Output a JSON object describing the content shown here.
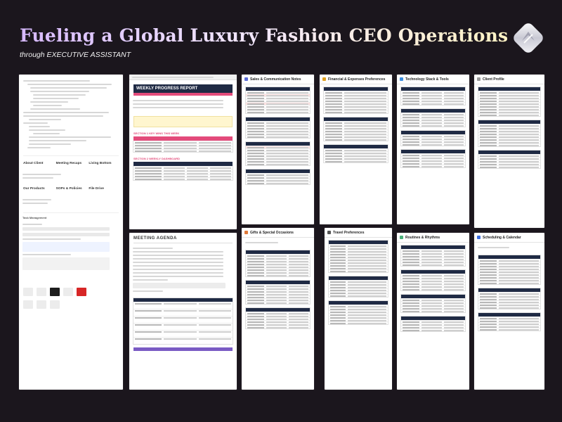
{
  "header": {
    "title": "Fueling a Global Luxury Fashion CEO Operations",
    "subtitle": "through EXECUTIVE ASSISTANT"
  },
  "colors": {
    "background": "#1b161d",
    "navy": "#1f2a44",
    "pink": "#e34b7b",
    "purple": "#7a5bc4"
  },
  "docs": {
    "notion": {
      "tiles": [
        {
          "label": "About Client"
        },
        {
          "label": "Meeting Recaps"
        },
        {
          "label": "Living Bottom"
        },
        {
          "label": "Our Products"
        },
        {
          "label": "SOPs & Policies"
        },
        {
          "label": "File Drive"
        }
      ],
      "section": "Task Management"
    },
    "weekly": {
      "title": "WEEKLY PROGRESS REPORT",
      "section1": "SECTION 1 KEY WINS THIS WEEK",
      "section2": "SECTION 2 WEEKLY DASHBOARD"
    },
    "agenda": {
      "title": "MEETING AGENDA"
    },
    "sales": {
      "title": "Sales & Communication Notes"
    },
    "financial": {
      "title": "Financial & Expenses Preferences"
    },
    "technology": {
      "title": "Technology Stack & Tools"
    },
    "client": {
      "title": "Client Profile"
    },
    "gifts": {
      "title": "Gifts & Special Occasions"
    },
    "travel": {
      "title": "Travel Preferences"
    },
    "routines": {
      "title": "Routines & Rhythms"
    },
    "scheduling": {
      "title": "Scheduling & Calendar"
    }
  }
}
